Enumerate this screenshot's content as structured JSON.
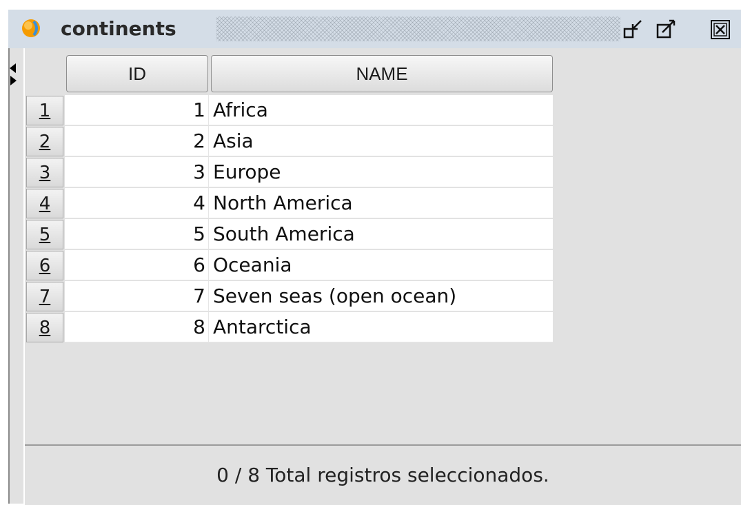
{
  "window": {
    "title": "continents",
    "app_icon": "database-app-icon",
    "buttons": {
      "minimize": "restore-down-icon",
      "maximize": "maximize-icon",
      "close": "close-icon"
    }
  },
  "grid": {
    "columns": [
      "ID",
      "NAME"
    ],
    "rows": [
      {
        "num": "1",
        "id": "1",
        "name": "Africa"
      },
      {
        "num": "2",
        "id": "2",
        "name": "Asia"
      },
      {
        "num": "3",
        "id": "3",
        "name": "Europe"
      },
      {
        "num": "4",
        "id": "4",
        "name": "North America"
      },
      {
        "num": "5",
        "id": "5",
        "name": "South America"
      },
      {
        "num": "6",
        "id": "6",
        "name": "Oceania"
      },
      {
        "num": "7",
        "id": "7",
        "name": "Seven seas (open ocean)"
      },
      {
        "num": "8",
        "id": "8",
        "name": "Antarctica"
      }
    ]
  },
  "status": {
    "text": "0 / 8 Total registros seleccionados."
  },
  "colors": {
    "titlebar": "#d4dde7",
    "panel": "#e1e1e1",
    "cell": "#ffffff",
    "icon_orange": "#f59b00"
  }
}
